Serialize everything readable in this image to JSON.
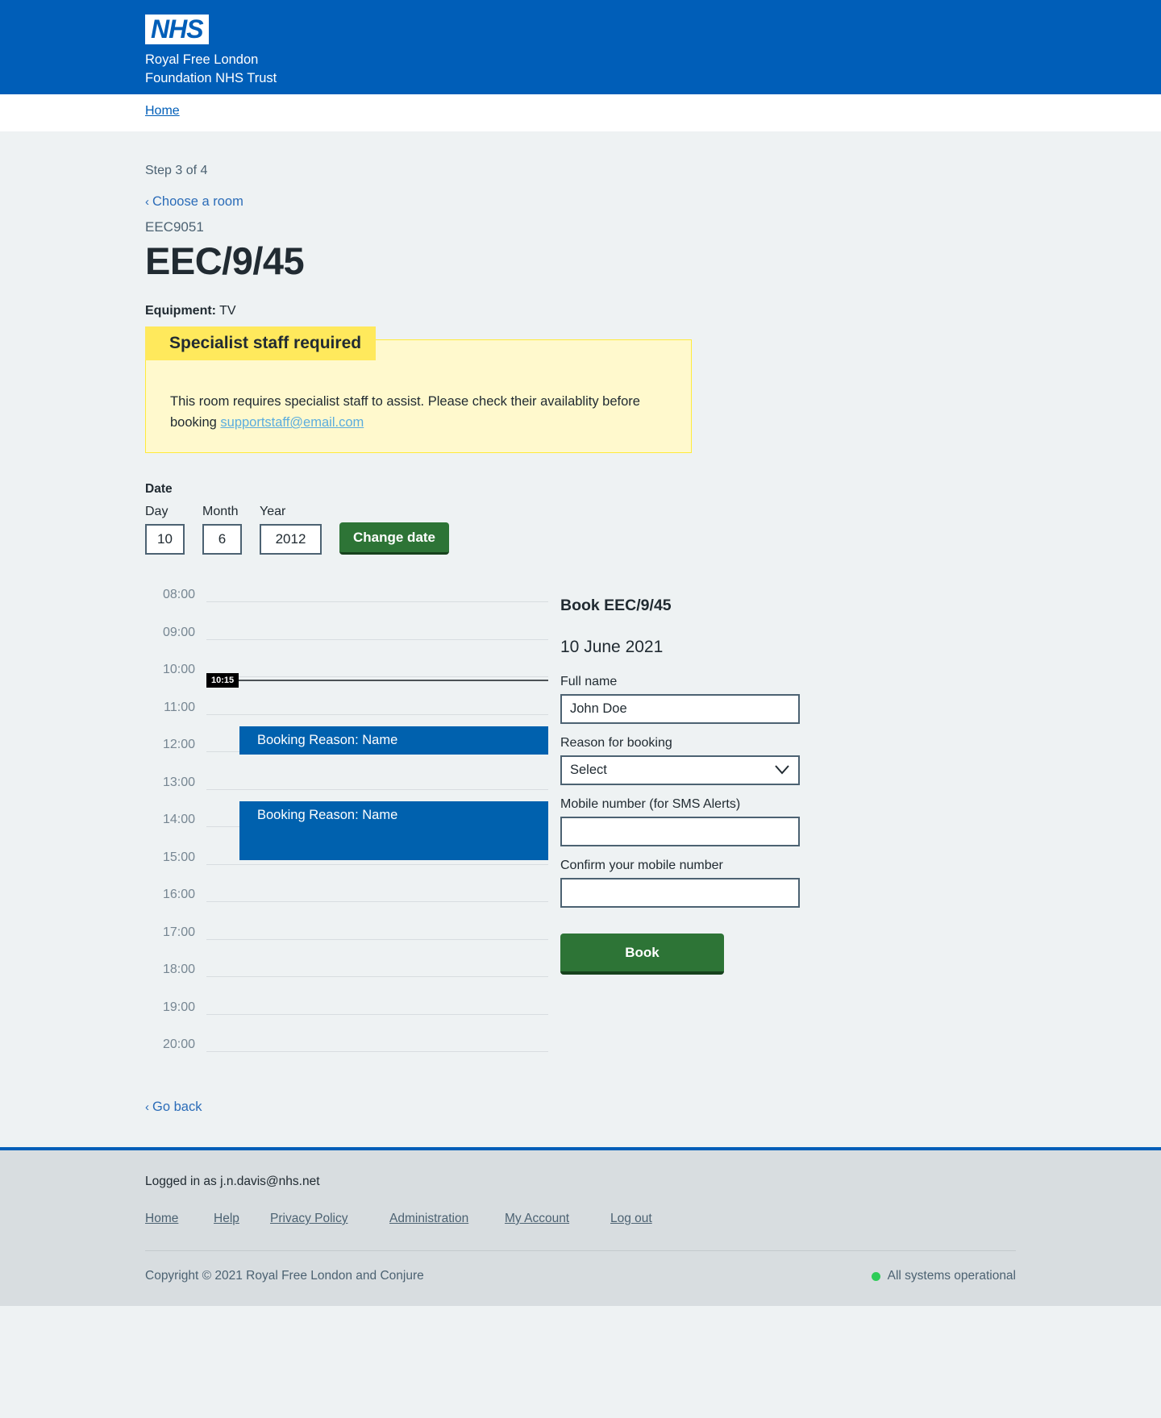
{
  "header": {
    "logo_text": "NHS",
    "trust_line_1": "Royal Free London",
    "trust_line_2": "Foundation NHS Trust"
  },
  "nav": {
    "home_label": "Home"
  },
  "page": {
    "step_text": "Step 3 of 4",
    "back_link_label": "Choose a room",
    "back_chevron": "‹",
    "room_code": "EEC9051",
    "room_title": "EEC/9/45",
    "equipment_label": "Equipment:",
    "equipment_value": "TV",
    "go_back_label": "Go back"
  },
  "warning": {
    "heading": "Specialist staff required",
    "body_text": "This room requires specialist staff to assist. Please check their availablity before booking ",
    "email_link": "supportstaff@email.com"
  },
  "date_picker": {
    "section_label": "Date",
    "day_label": "Day",
    "month_label": "Month",
    "year_label": "Year",
    "day_value": "10",
    "month_value": "6",
    "year_value": "2012",
    "change_button_label": "Change date"
  },
  "timeline": {
    "hours": [
      "08:00",
      "09:00",
      "10:00",
      "11:00",
      "12:00",
      "13:00",
      "14:00",
      "15:00",
      "16:00",
      "17:00",
      "18:00",
      "19:00",
      "20:00"
    ],
    "now_time": "10:15",
    "bookings": [
      {
        "label": "Booking Reason: Name",
        "start": "11:30",
        "end": "12:15"
      },
      {
        "label": "Booking Reason: Name",
        "start": "13:30",
        "end": "15:05"
      }
    ]
  },
  "booking_form": {
    "title": "Book EEC/9/45",
    "date": "10 June 2021",
    "full_name_label": "Full name",
    "full_name_value": "John Doe",
    "reason_label": "Reason for booking",
    "reason_value": "Select",
    "mobile_label": "Mobile number (for SMS Alerts)",
    "mobile_value": "",
    "confirm_mobile_label": "Confirm your mobile number",
    "confirm_mobile_value": "",
    "book_button_label": "Book"
  },
  "footer": {
    "logged_in_text": "Logged in as j.n.davis@nhs.net",
    "links": [
      "Home",
      "Help",
      "Privacy Policy",
      "Administration",
      "My Account",
      "Log out"
    ],
    "copyright": "Copyright © 2021 Royal Free London and Conjure",
    "status_text": "All systems operational",
    "status_color": "#2ecc58"
  },
  "colors": {
    "nhs_blue": "#005eb8",
    "booking_blue": "#0061ae",
    "green": "#2d7436",
    "warning_heading_bg": "#ffe95c",
    "warning_body_bg": "#fff9cd"
  }
}
